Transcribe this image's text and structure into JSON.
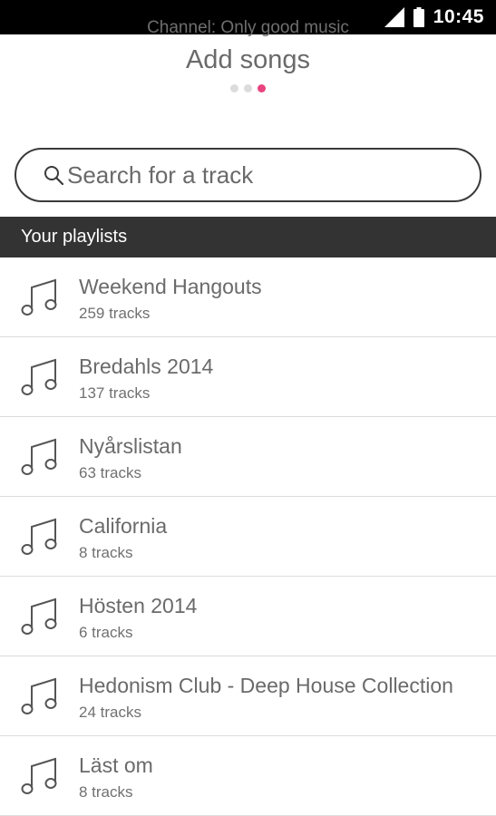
{
  "status_bar": {
    "time": "10:45",
    "icons": [
      "signal-icon",
      "battery-icon"
    ]
  },
  "header": {
    "channel": "Channel: Only good music",
    "title": "Add songs",
    "steps_total": 3,
    "step_active": 3,
    "accent_color": "#e8437f"
  },
  "search": {
    "placeholder": "Search for a track",
    "value": "",
    "icon": "search-icon"
  },
  "section": {
    "title": "Your playlists"
  },
  "playlists": [
    {
      "name": "Weekend Hangouts",
      "count": "259 tracks",
      "icon": "music-note-icon"
    },
    {
      "name": "Bredahls 2014",
      "count": "137 tracks",
      "icon": "music-note-icon"
    },
    {
      "name": "Nyårslistan",
      "count": "63 tracks",
      "icon": "music-note-icon"
    },
    {
      "name": "California",
      "count": "8 tracks",
      "icon": "music-note-icon"
    },
    {
      "name": "Hösten 2014",
      "count": "6 tracks",
      "icon": "music-note-icon"
    },
    {
      "name": "Hedonism Club - Deep House Collection",
      "count": "24 tracks",
      "icon": "music-note-icon"
    },
    {
      "name": "Läst om",
      "count": "8 tracks",
      "icon": "music-note-icon"
    }
  ]
}
